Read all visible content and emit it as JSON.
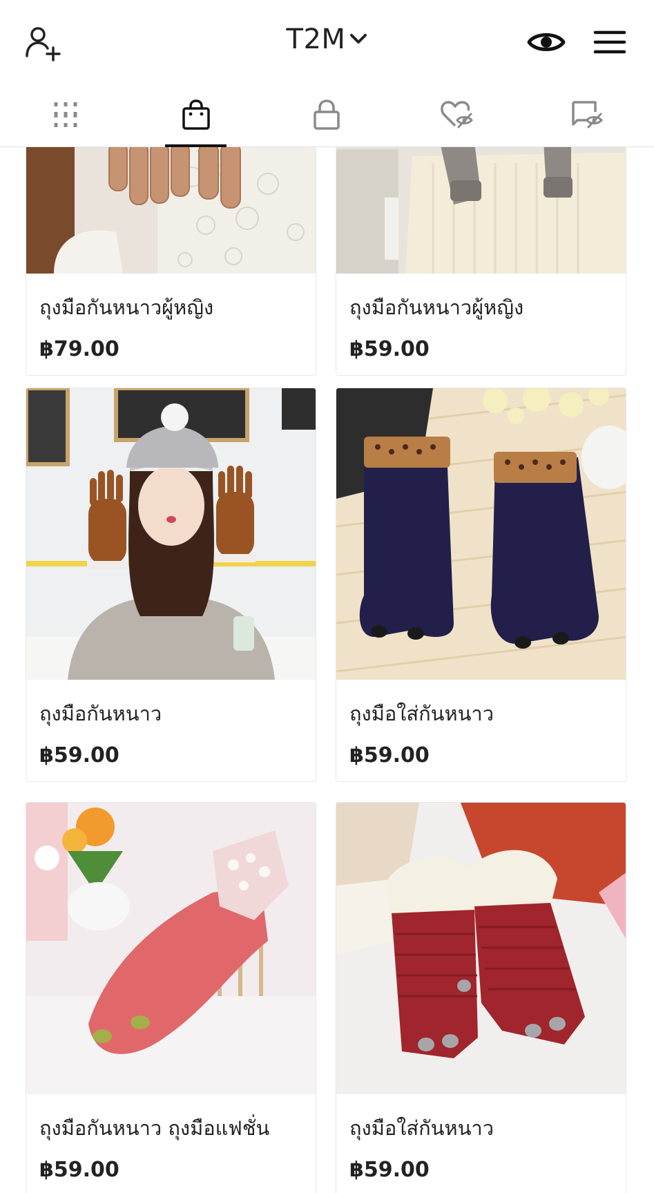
{
  "header": {
    "account_name": "T2M",
    "add_user_icon": "add-user-icon",
    "account_switch_icon": "chevron-down-icon",
    "preview_icon": "eye-icon",
    "menu_icon": "hamburger-menu-icon"
  },
  "tabs": [
    {
      "icon": "grid-icon"
    },
    {
      "icon": "shopping-bag-icon",
      "active": true
    },
    {
      "icon": "lock-icon"
    },
    {
      "icon": "heart-hidden-icon"
    },
    {
      "icon": "tag-hidden-icon"
    }
  ],
  "products": [
    {
      "title": "ถุงมือกันหนาวผู้หญิง",
      "price": "฿79.00",
      "image": "beige-gloves-lace-top-photo"
    },
    {
      "title": "ถุงมือกันหนาวผู้หญิง",
      "price": "฿59.00",
      "image": "grey-gloves-cream-sweater-photo"
    },
    {
      "title": "ถุงมือกันหนาว",
      "price": "฿59.00",
      "image": "woman-brown-gloves-knit-hat-photo"
    },
    {
      "title": "ถุงมือใส่กันหนาว",
      "price": "฿59.00",
      "image": "navy-knit-gloves-photo"
    },
    {
      "title": "ถุงมือกันหนาว ถุงมือแฟชั่น",
      "price": "฿59.00",
      "image": "pink-lace-gloves-photo"
    },
    {
      "title": "ถุงมือใส่กันหนาว",
      "price": "฿59.00",
      "image": "red-gloves-fur-cuff-photo"
    }
  ],
  "colors": {
    "text": "#222222",
    "divider": "#e3e3e3",
    "tab_icon": "#8a8a8a",
    "active_indicator": "#111111"
  }
}
